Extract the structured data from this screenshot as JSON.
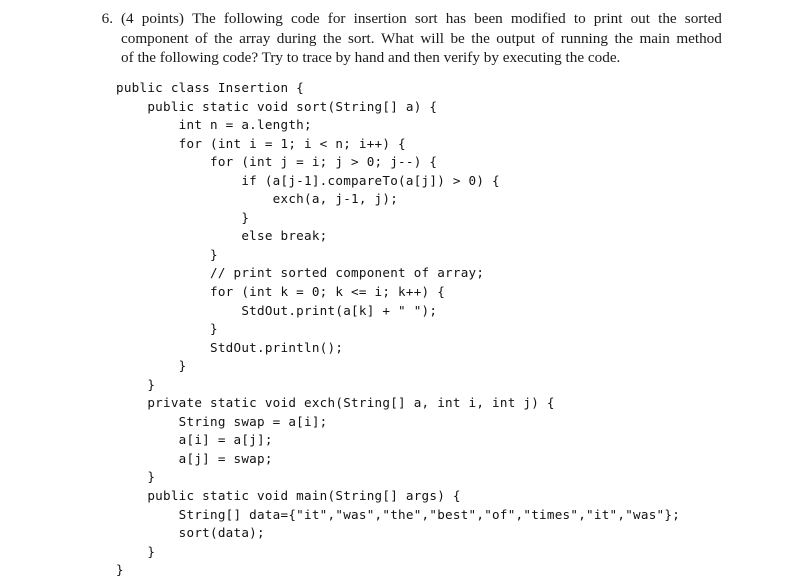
{
  "question": {
    "number": "6.",
    "lines": [
      "(4 points) The following code for insertion sort has been modified to print out the sorted",
      "component of the array during the sort. What will be the output of running the main method",
      "of the following code? Try to trace by hand and then verify by executing the code."
    ]
  },
  "code": {
    "language": "java",
    "lines": [
      "public class Insertion {",
      "    public static void sort(String[] a) {",
      "        int n = a.length;",
      "        for (int i = 1; i < n; i++) {",
      "            for (int j = i; j > 0; j--) {",
      "                if (a[j-1].compareTo(a[j]) > 0) {",
      "                    exch(a, j-1, j);",
      "                }",
      "                else break;",
      "            }",
      "            // print sorted component of array;",
      "            for (int k = 0; k <= i; k++) {",
      "                StdOut.print(a[k] + \" \");",
      "            }",
      "            StdOut.println();",
      "        }",
      "    }",
      "    private static void exch(String[] a, int i, int j) {",
      "        String swap = a[i];",
      "        a[i] = a[j];",
      "        a[j] = swap;",
      "    }",
      "    public static void main(String[] args) {",
      "        String[] data={\"it\",\"was\",\"the\",\"best\",\"of\",\"times\",\"it\",\"was\"};",
      "        sort(data);",
      "    }",
      "}"
    ],
    "class_name": "Insertion",
    "methods": [
      "sort",
      "exch",
      "main"
    ],
    "data_array": [
      "it",
      "was",
      "the",
      "best",
      "of",
      "times",
      "it",
      "was"
    ]
  }
}
